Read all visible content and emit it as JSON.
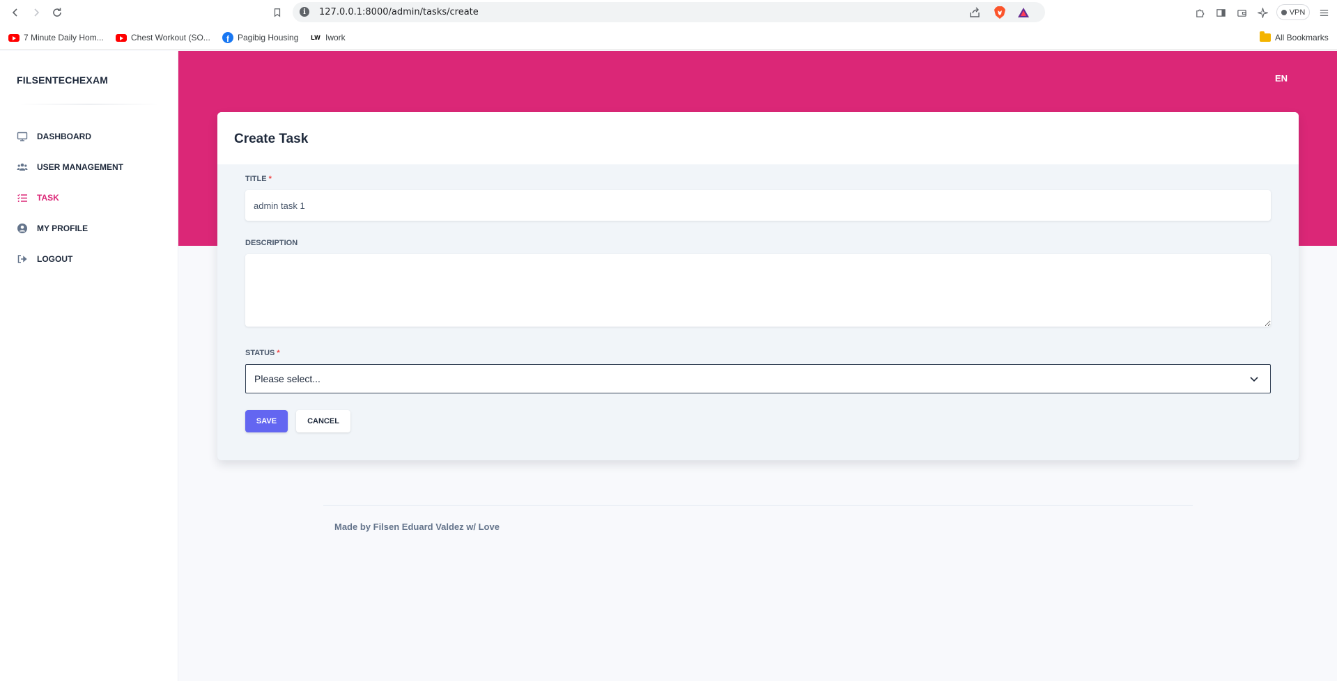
{
  "browser": {
    "url": "127.0.0.1:8000/admin/tasks/create",
    "vpn_label": "VPN",
    "bookmarks": [
      {
        "label": "7 Minute Daily Hom...",
        "icon": "youtube-icon"
      },
      {
        "label": "Chest Workout (SO...",
        "icon": "youtube-icon"
      },
      {
        "label": "Pagibig Housing",
        "icon": "facebook-icon"
      },
      {
        "label": "Iwork",
        "icon": "lw-icon"
      }
    ],
    "all_bookmarks": "All Bookmarks"
  },
  "sidebar": {
    "brand": "FILSENTECHEXAM",
    "items": [
      {
        "label": "DASHBOARD",
        "icon": "monitor-icon"
      },
      {
        "label": "USER MANAGEMENT",
        "icon": "users-icon"
      },
      {
        "label": "TASK",
        "icon": "list-icon",
        "active": true
      },
      {
        "label": "MY PROFILE",
        "icon": "user-circle-icon"
      },
      {
        "label": "LOGOUT",
        "icon": "sign-out-icon"
      }
    ]
  },
  "header": {
    "language": "EN",
    "accent_color": "#db2777"
  },
  "form": {
    "title": "Create Task",
    "title_label": "TITLE",
    "title_value": "admin task 1",
    "required_mark": "*",
    "description_label": "DESCRIPTION",
    "description_value": "",
    "status_label": "STATUS",
    "status_placeholder": "Please select...",
    "save_label": "SAVE",
    "cancel_label": "CANCEL",
    "save_color": "#6366f1"
  },
  "footer": {
    "text": "Made by Filsen Eduard Valdez w/ Love"
  }
}
